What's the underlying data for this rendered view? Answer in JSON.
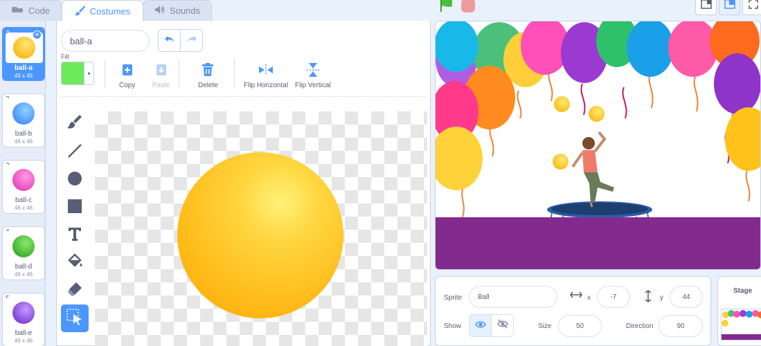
{
  "tabs": [
    {
      "label": "Code",
      "icon": "code-icon"
    },
    {
      "label": "Costumes",
      "icon": "brush-icon"
    },
    {
      "label": "Sounds",
      "icon": "speaker-icon"
    }
  ],
  "costumes": [
    {
      "num": "1",
      "name": "ball-a",
      "size": "45 x 45",
      "color": "#ffc21a"
    },
    {
      "num": "2",
      "name": "ball-b",
      "size": "46 x 46",
      "color": "#3d9bff"
    },
    {
      "num": "3",
      "name": "ball-c",
      "size": "46 x 46",
      "color": "#f052c4"
    },
    {
      "num": "4",
      "name": "ball-d",
      "size": "46 x 46",
      "color": "#3fbf2c"
    },
    {
      "num": "5",
      "name": "ball-e",
      "size": "46 x 46",
      "color": "#8a3de0"
    }
  ],
  "editor": {
    "costume_name": "ball-a",
    "fill_label": "Fill",
    "fill_color": "#6dea5c",
    "copy_label": "Copy",
    "paste_label": "Paste",
    "delete_label": "Delete",
    "flip_h_label": "Flip Horizontal",
    "flip_v_label": "Flip Vertical"
  },
  "sprite": {
    "sprite_label": "Sprite",
    "name": "Ball",
    "x_label": "x",
    "x": "-7",
    "y_label": "y",
    "y": "44",
    "show_label": "Show",
    "size_label": "Size",
    "size": "50",
    "direction_label": "Direction",
    "direction": "90"
  },
  "stage_panel": {
    "label": "Stage"
  },
  "colors": {
    "accent": "#4c97ff",
    "floor": "#822a8d"
  }
}
